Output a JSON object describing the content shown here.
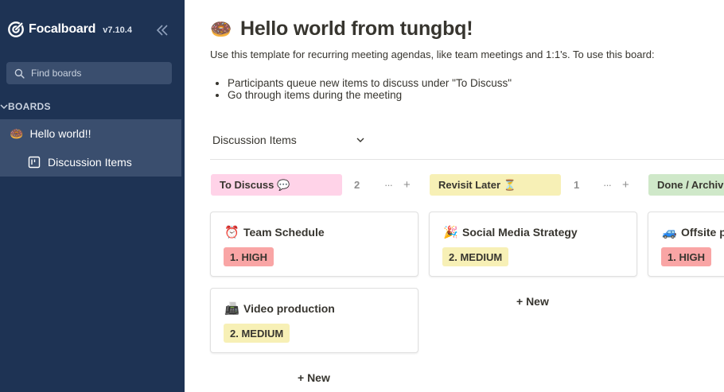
{
  "app": {
    "name": "Focalboard",
    "version": "v7.10.4"
  },
  "sidebar": {
    "search_placeholder": "Find boards",
    "section_label": "BOARDS",
    "board": {
      "icon": "🍩",
      "label": "Hello world!!"
    },
    "view": {
      "icon": "board-view-icon",
      "label": "Discussion Items"
    }
  },
  "board": {
    "icon": "🍩",
    "title": "Hello world from tungbq!",
    "description": "Use this template for recurring meeting agendas, like team meetings and 1:1's. To use this board:",
    "bullets": [
      "Participants queue new items to discuss under \"To Discuss\"",
      "Go through items during the meeting"
    ],
    "view_selector": "Discussion Items"
  },
  "columns": [
    {
      "label": "To Discuss 💬",
      "count": "2",
      "color": "#ffd3e8",
      "cards": [
        {
          "icon": "⏰",
          "title": "Team Schedule",
          "priority": "1. HIGH",
          "priority_color": "#f9a5a5"
        },
        {
          "icon": "📠",
          "title": "Video production",
          "priority": "2. MEDIUM",
          "priority_color": "#f7f0b6"
        }
      ],
      "new_label": "+ New"
    },
    {
      "label": "Revisit Later ⏳",
      "count": "1",
      "color": "#f7f0b6",
      "cards": [
        {
          "icon": "🎉",
          "title": "Social Media Strategy",
          "priority": "2. MEDIUM",
          "priority_color": "#f7f0b6"
        }
      ],
      "new_label": "+ New"
    },
    {
      "label": "Done / Archiv",
      "color": "#cfe8c9",
      "cards": [
        {
          "icon": "🚙",
          "title": "Offsite p",
          "priority": "1. HIGH",
          "priority_color": "#f9a5a5"
        }
      ]
    }
  ],
  "header_more_glyph": "···",
  "header_add_glyph": "+"
}
